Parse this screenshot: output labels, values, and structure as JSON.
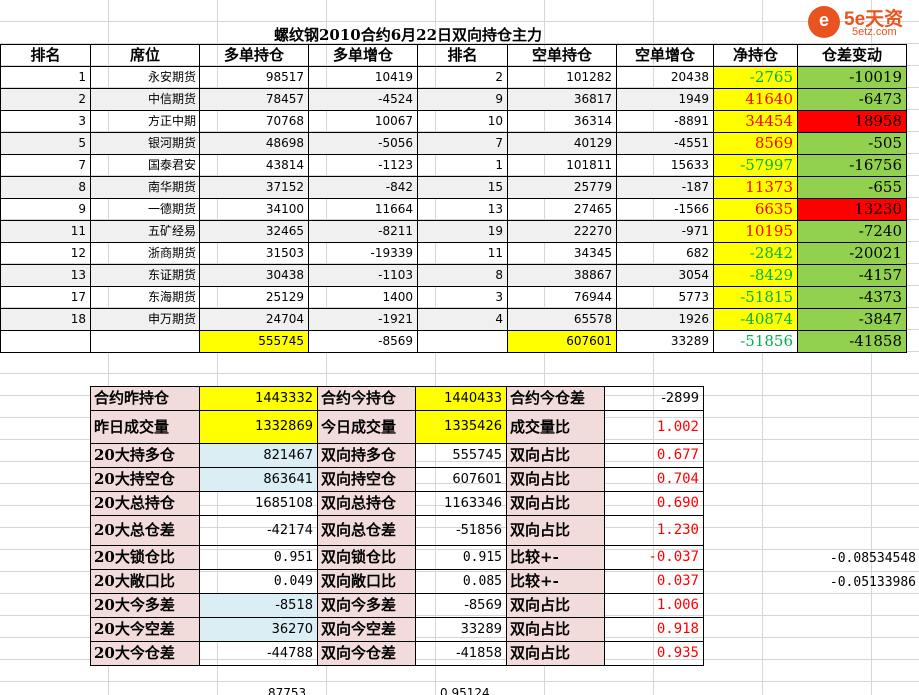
{
  "title": "螺纹钢2010合约6月22日双向持仓主力",
  "logo": {
    "icon": "5e-circle-logo",
    "mark": "e",
    "main": "5e天资",
    "sub": "5etz.com"
  },
  "headers": [
    "排名",
    "席位",
    "多单持仓",
    "多单增仓",
    "排名",
    "空单持仓",
    "空单增仓",
    "净持仓",
    "仓差变动"
  ],
  "rows": [
    {
      "rank_long": "1",
      "seat": "永安期货",
      "long": "98517",
      "long_chg": "10419",
      "rank_short": "2",
      "short": "101282",
      "short_chg": "20438",
      "net": "-2765",
      "diff": "-10019"
    },
    {
      "rank_long": "2",
      "seat": "中信期货",
      "long": "78457",
      "long_chg": "-4524",
      "rank_short": "9",
      "short": "36817",
      "short_chg": "1949",
      "net": "41640",
      "diff": "-6473"
    },
    {
      "rank_long": "3",
      "seat": "方正中期",
      "long": "70768",
      "long_chg": "10067",
      "rank_short": "10",
      "short": "36314",
      "short_chg": "-8891",
      "net": "34454",
      "diff": "18958"
    },
    {
      "rank_long": "5",
      "seat": "银河期货",
      "long": "48698",
      "long_chg": "-5056",
      "rank_short": "7",
      "short": "40129",
      "short_chg": "-4551",
      "net": "8569",
      "diff": "-505"
    },
    {
      "rank_long": "7",
      "seat": "国泰君安",
      "long": "43814",
      "long_chg": "-1123",
      "rank_short": "1",
      "short": "101811",
      "short_chg": "15633",
      "net": "-57997",
      "diff": "-16756"
    },
    {
      "rank_long": "8",
      "seat": "南华期货",
      "long": "37152",
      "long_chg": "-842",
      "rank_short": "15",
      "short": "25779",
      "short_chg": "-187",
      "net": "11373",
      "diff": "-655"
    },
    {
      "rank_long": "9",
      "seat": "一德期货",
      "long": "34100",
      "long_chg": "11664",
      "rank_short": "13",
      "short": "27465",
      "short_chg": "-1566",
      "net": "6635",
      "diff": "13230"
    },
    {
      "rank_long": "11",
      "seat": "五矿经易",
      "long": "32465",
      "long_chg": "-8211",
      "rank_short": "19",
      "short": "22270",
      "short_chg": "-971",
      "net": "10195",
      "diff": "-7240"
    },
    {
      "rank_long": "12",
      "seat": "浙商期货",
      "long": "31503",
      "long_chg": "-19339",
      "rank_short": "11",
      "short": "34345",
      "short_chg": "682",
      "net": "-2842",
      "diff": "-20021"
    },
    {
      "rank_long": "13",
      "seat": "东证期货",
      "long": "30438",
      "long_chg": "-1103",
      "rank_short": "8",
      "short": "38867",
      "short_chg": "3054",
      "net": "-8429",
      "diff": "-4157"
    },
    {
      "rank_long": "17",
      "seat": "东海期货",
      "long": "25129",
      "long_chg": "1400",
      "rank_short": "3",
      "short": "76944",
      "short_chg": "5773",
      "net": "-51815",
      "diff": "-4373"
    },
    {
      "rank_long": "18",
      "seat": "申万期货",
      "long": "24704",
      "long_chg": "-1921",
      "rank_short": "4",
      "short": "65578",
      "short_chg": "1926",
      "net": "-40874",
      "diff": "-3847"
    }
  ],
  "totals": {
    "long": "555745",
    "long_chg": "-8569",
    "short": "607601",
    "short_chg": "33289",
    "net": "-51856",
    "diff": "-41858"
  },
  "stats": [
    {
      "l1": "合约昨持仓",
      "v1": "1443332",
      "l2": "合约今持仓",
      "v2": "1440433",
      "l3": "合约今仓差",
      "v3": "-2899"
    },
    {
      "l1": "昨日成交量",
      "v1": "1332869",
      "l2": "今日成交量",
      "v2": "1335426",
      "l3": "成交量比",
      "v3": "1.002"
    },
    {
      "l1": "20大持多仓",
      "v1": "821467",
      "l2": "双向持多仓",
      "v2": "555745",
      "l3": "双向占比",
      "v3": "0.677"
    },
    {
      "l1": "20大持空仓",
      "v1": "863641",
      "l2": "双向持空仓",
      "v2": "607601",
      "l3": "双向占比",
      "v3": "0.704"
    },
    {
      "l1": "20大总持仓",
      "v1": "1685108",
      "l2": "双向总持仓",
      "v2": "1163346",
      "l3": "双向占比",
      "v3": "0.690"
    },
    {
      "l1": "20大总仓差",
      "v1": "-42174",
      "l2": "双向总仓差",
      "v2": "-51856",
      "l3": "双向占比",
      "v3": "1.230"
    },
    {
      "l1": "20大锁仓比",
      "v1": "0.951",
      "l2": "双向锁仓比",
      "v2": "0.915",
      "l3": "比较+-",
      "v3": "-0.037"
    },
    {
      "l1": "20大敞口比",
      "v1": "0.049",
      "l2": "双向敞口比",
      "v2": "0.085",
      "l3": "比较+-",
      "v3": "0.037"
    },
    {
      "l1": "20大今多差",
      "v1": "-8518",
      "l2": "双向今多差",
      "v2": "-8569",
      "l3": "双向占比",
      "v3": "1.006"
    },
    {
      "l1": "20大今空差",
      "v1": "36270",
      "l2": "双向今空差",
      "v2": "33289",
      "l3": "双向占比",
      "v3": "0.918"
    },
    {
      "l1": "20大今仓差",
      "v1": "-44788",
      "l2": "双向今仓差",
      "v2": "-41858",
      "l3": "双向占比",
      "v3": "0.935"
    }
  ],
  "side_values": [
    "-0.08534548",
    "-0.05133986"
  ],
  "bottom_clipped": [
    "87753",
    "0.95124"
  ],
  "colors": {
    "net_bg": "#ffff00",
    "diff_bg": "#92d050",
    "diff_hot": "#ff0000",
    "positive_text": "#ff0000",
    "negative_text": "#00b050",
    "label_bg": "#f2dcdb",
    "highlight_blue": "#daeef3"
  }
}
